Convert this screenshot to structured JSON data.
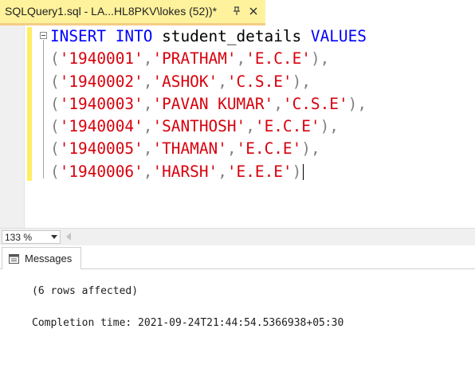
{
  "tab": {
    "title": "SQLQuery1.sql - LA...HL8PKV\\lokes (52))*",
    "pin_icon": "pin-icon",
    "close_icon": "close-icon"
  },
  "editor": {
    "lines": [
      [
        {
          "t": "INSERT",
          "c": "kw"
        },
        {
          "t": " ",
          "c": "id"
        },
        {
          "t": "INTO",
          "c": "kw"
        },
        {
          "t": " student_details ",
          "c": "id"
        },
        {
          "t": "VALUES",
          "c": "kw"
        }
      ],
      [
        {
          "t": "(",
          "c": "pun"
        },
        {
          "t": "'1940001'",
          "c": "str"
        },
        {
          "t": ",",
          "c": "pun"
        },
        {
          "t": "'PRATHAM'",
          "c": "str"
        },
        {
          "t": ",",
          "c": "pun"
        },
        {
          "t": "'E.C.E'",
          "c": "str"
        },
        {
          "t": "),",
          "c": "pun"
        }
      ],
      [
        {
          "t": "(",
          "c": "pun"
        },
        {
          "t": "'1940002'",
          "c": "str"
        },
        {
          "t": ",",
          "c": "pun"
        },
        {
          "t": "'ASHOK'",
          "c": "str"
        },
        {
          "t": ",",
          "c": "pun"
        },
        {
          "t": "'C.S.E'",
          "c": "str"
        },
        {
          "t": "),",
          "c": "pun"
        }
      ],
      [
        {
          "t": "(",
          "c": "pun"
        },
        {
          "t": "'1940003'",
          "c": "str"
        },
        {
          "t": ",",
          "c": "pun"
        },
        {
          "t": "'PAVAN KUMAR'",
          "c": "str"
        },
        {
          "t": ",",
          "c": "pun"
        },
        {
          "t": "'C.S.E'",
          "c": "str"
        },
        {
          "t": "),",
          "c": "pun"
        }
      ],
      [
        {
          "t": "(",
          "c": "pun"
        },
        {
          "t": "'1940004'",
          "c": "str"
        },
        {
          "t": ",",
          "c": "pun"
        },
        {
          "t": "'SANTHOSH'",
          "c": "str"
        },
        {
          "t": ",",
          "c": "pun"
        },
        {
          "t": "'E.C.E'",
          "c": "str"
        },
        {
          "t": "),",
          "c": "pun"
        }
      ],
      [
        {
          "t": "(",
          "c": "pun"
        },
        {
          "t": "'1940005'",
          "c": "str"
        },
        {
          "t": ",",
          "c": "pun"
        },
        {
          "t": "'THAMAN'",
          "c": "str"
        },
        {
          "t": ",",
          "c": "pun"
        },
        {
          "t": "'E.C.E'",
          "c": "str"
        },
        {
          "t": "),",
          "c": "pun"
        }
      ],
      [
        {
          "t": "(",
          "c": "pun"
        },
        {
          "t": "'1940006'",
          "c": "str"
        },
        {
          "t": ",",
          "c": "pun"
        },
        {
          "t": "'HARSH'",
          "c": "str"
        },
        {
          "t": ",",
          "c": "pun"
        },
        {
          "t": "'E.E.E'",
          "c": "str"
        },
        {
          "t": ")",
          "c": "pun"
        }
      ]
    ],
    "colors": {
      "keyword": "#0000ff",
      "string": "#d8000c",
      "punctuation": "#808080",
      "identifier": "#000000"
    }
  },
  "status": {
    "zoom": "133 %"
  },
  "results": {
    "tab_label": "Messages",
    "tab_icon": "messages-icon",
    "line1": "(6 rows affected)",
    "line2": "Completion time: 2021-09-24T21:44:54.5366938+05:30"
  }
}
